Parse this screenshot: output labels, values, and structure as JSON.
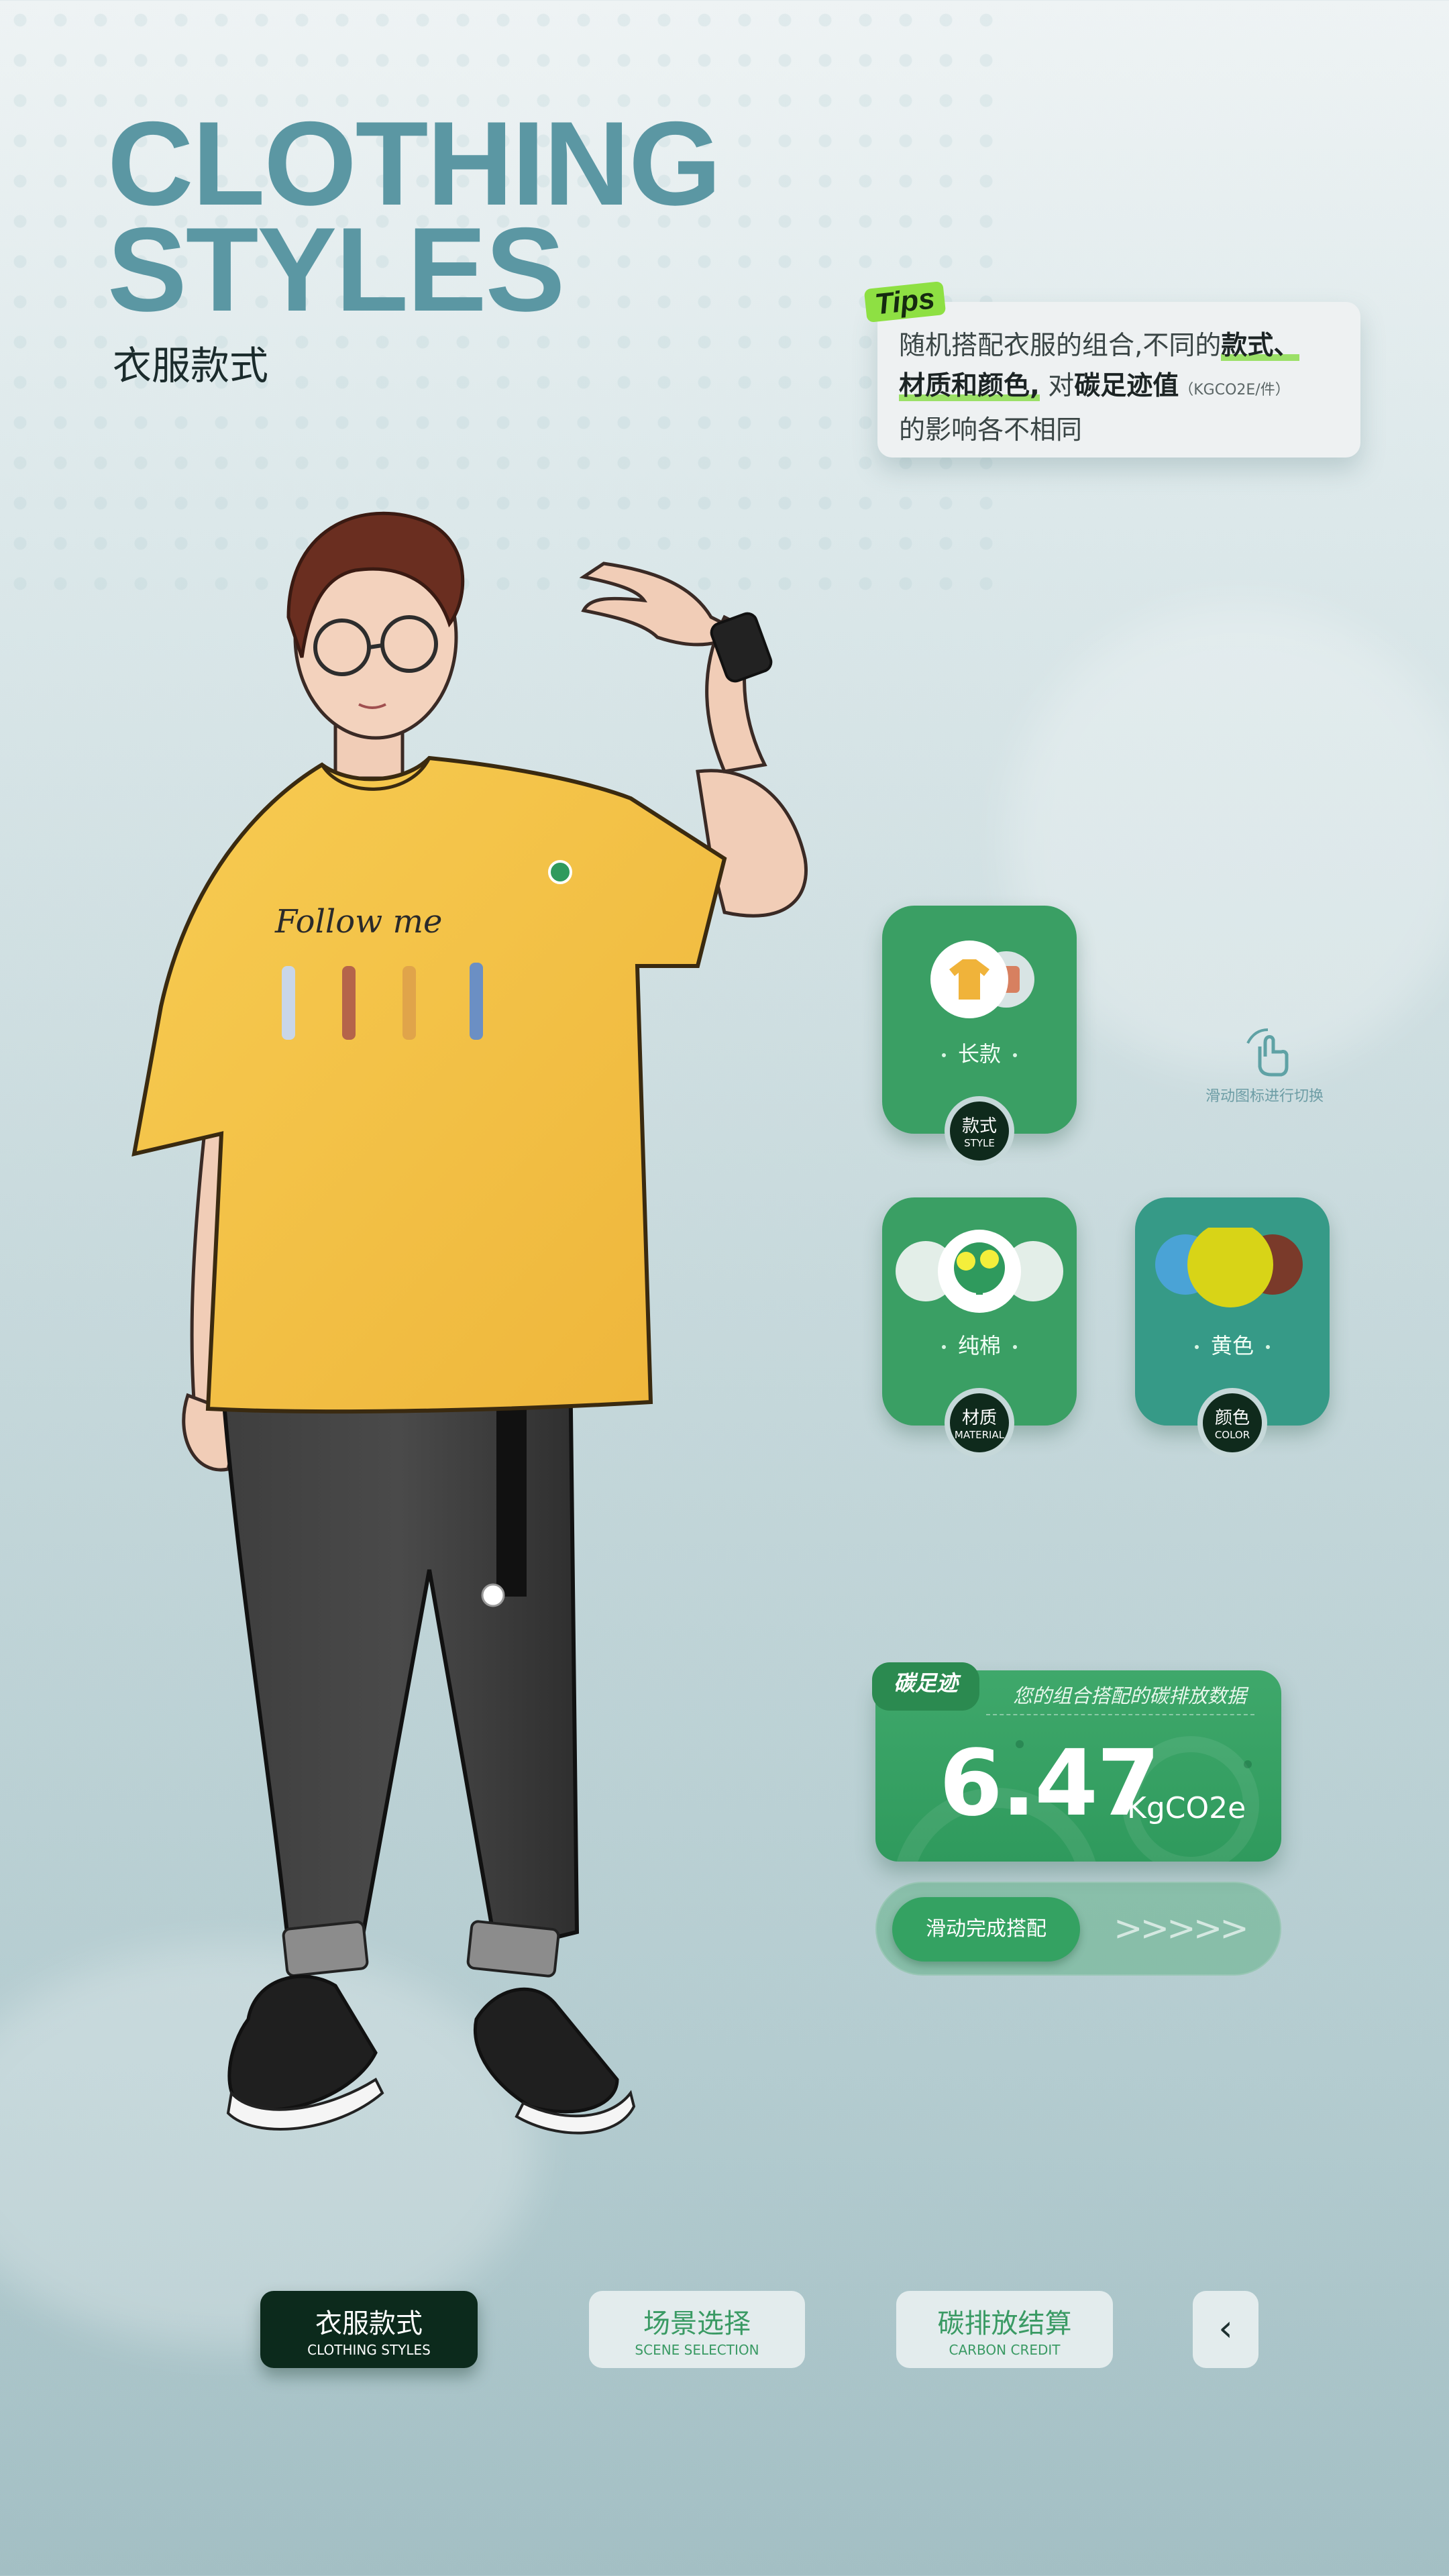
{
  "header": {
    "title_line1": "CLOTHING",
    "title_line2": "STYLES",
    "subtitle": "衣服款式"
  },
  "tips": {
    "tag": "Tips",
    "part1": "随机搭配衣服的组合,不同的",
    "emph1": "款式、",
    "emph2": "材质和颜色,",
    "part2": " 对",
    "emph3": "碳足迹值",
    "unit": "（KGCO2E/件）",
    "part3": "的影响各不相同"
  },
  "character": {
    "shirt_text": "Follow me"
  },
  "options": {
    "style": {
      "value": "长款",
      "badge_zh": "款式",
      "badge_en": "STYLE"
    },
    "material": {
      "value": "纯棉",
      "badge_zh": "材质",
      "badge_en": "MATERIAL"
    },
    "color": {
      "value": "黄色",
      "badge_zh": "颜色",
      "badge_en": "COLOR"
    },
    "hint": "滑动图标进行切换"
  },
  "carbon": {
    "tab": "碳足迹",
    "caption": "您的组合搭配的碳排放数据",
    "value": "6.47",
    "unit": "KgCO2e"
  },
  "slider": {
    "label": "滑动完成搭配",
    "arrows": ">>>>>"
  },
  "nav": {
    "items": [
      {
        "zh": "衣服款式",
        "en": "CLOTHING STYLES"
      },
      {
        "zh": "场景选择",
        "en": "SCENE SELECTION"
      },
      {
        "zh": "碳排放结算",
        "en": "CARBON CREDIT"
      }
    ],
    "back": "‹"
  },
  "colors": {
    "accent_green": "#3a9f64",
    "accent_teal": "#369a87",
    "title_blue": "#5b97a3",
    "dark": "#0c2a1c",
    "shirt_yellow": "#f4c14a"
  }
}
